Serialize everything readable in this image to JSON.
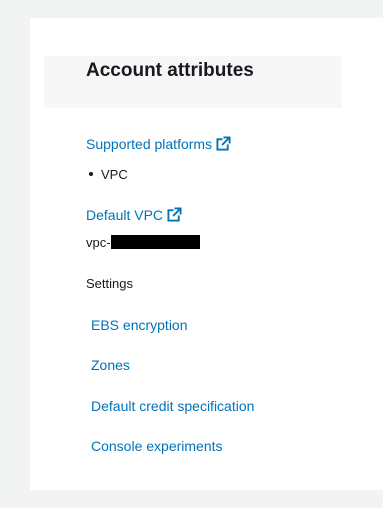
{
  "panel": {
    "title": "Account attributes"
  },
  "supported_platforms": {
    "label": "Supported platforms",
    "icon": "external-link-icon",
    "items": [
      "VPC"
    ]
  },
  "default_vpc": {
    "label": "Default VPC",
    "icon": "external-link-icon",
    "value_prefix": "vpc-"
  },
  "settings": {
    "heading": "Settings",
    "links": [
      {
        "label": "EBS encryption"
      },
      {
        "label": "Zones"
      },
      {
        "label": "Default credit specification"
      },
      {
        "label": "Console experiments"
      }
    ]
  },
  "colors": {
    "link": "#0073bb",
    "text": "#16191f",
    "background": "#f2f3f3",
    "panel": "#ffffff",
    "header": "#f7f7f7"
  }
}
